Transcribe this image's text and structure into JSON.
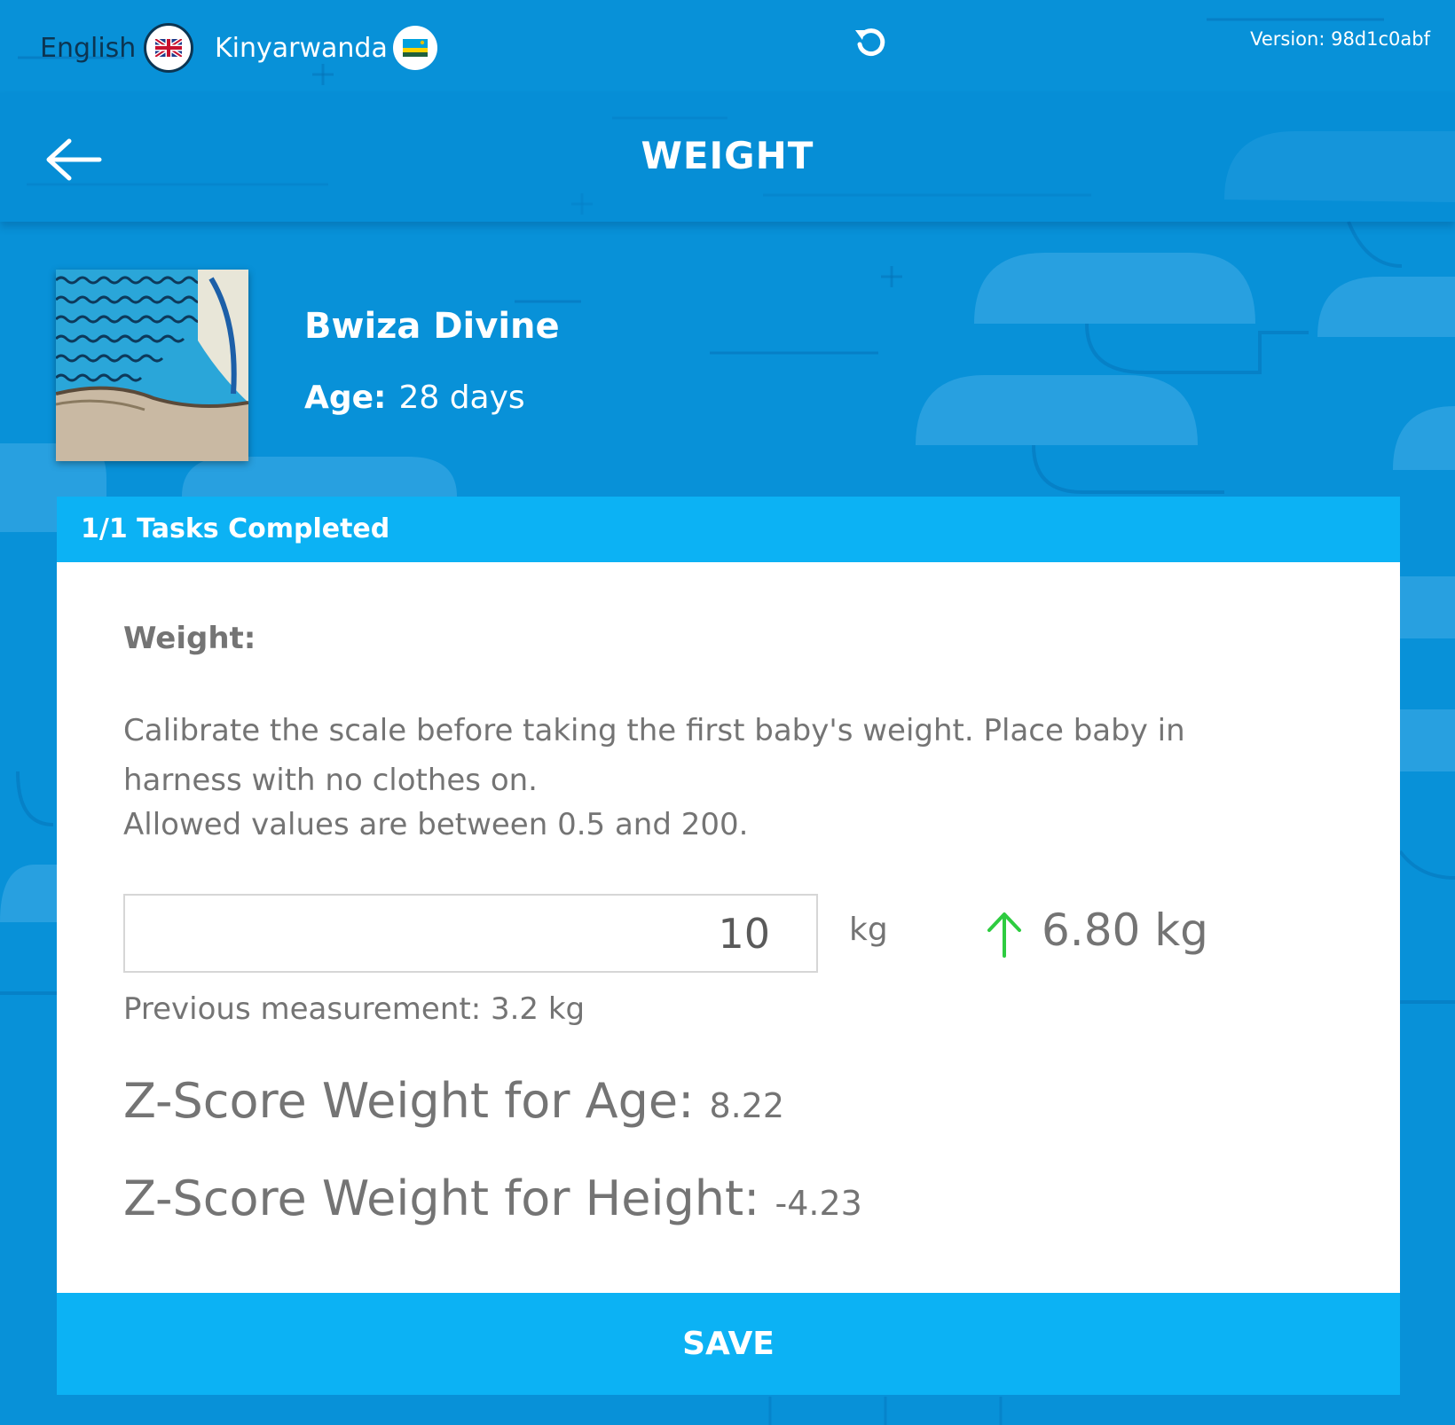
{
  "colors": {
    "background": "#0891d8",
    "accent": "#0cb2f4",
    "text_muted": "#747474",
    "increase_arrow": "#2ecc40",
    "dark_navy": "#0c3552"
  },
  "topbar": {
    "languages": [
      {
        "label": "English",
        "flag_icon": "uk-flag-icon",
        "selected": true
      },
      {
        "label": "Kinyarwanda",
        "flag_icon": "rwanda-flag-icon",
        "selected": false
      }
    ],
    "refresh_icon": "refresh-icon",
    "version": "Version: 98d1c0abf"
  },
  "header": {
    "back_icon": "arrow-left-icon",
    "title": "WEIGHT"
  },
  "child": {
    "name": "Bwiza Divine",
    "age_label": "Age:",
    "age_value": "28 days"
  },
  "card": {
    "tasks_completed": "1/1 Tasks Completed",
    "field_label": "Weight:",
    "instructions": "Calibrate the scale before taking the first baby's weight. Place baby in harness with no clothes on.",
    "allowed": "Allowed values are between 0.5 and 200.",
    "input_value": "10",
    "unit": "kg",
    "difference_icon": "arrow-up-icon",
    "difference": "6.80 kg",
    "previous": "Previous measurement: 3.2 kg",
    "zscores": [
      {
        "label": "Z-Score Weight for Age:",
        "value": "8.22"
      },
      {
        "label": "Z-Score Weight for Height:",
        "value": "-4.23"
      }
    ],
    "save_label": "SAVE"
  }
}
